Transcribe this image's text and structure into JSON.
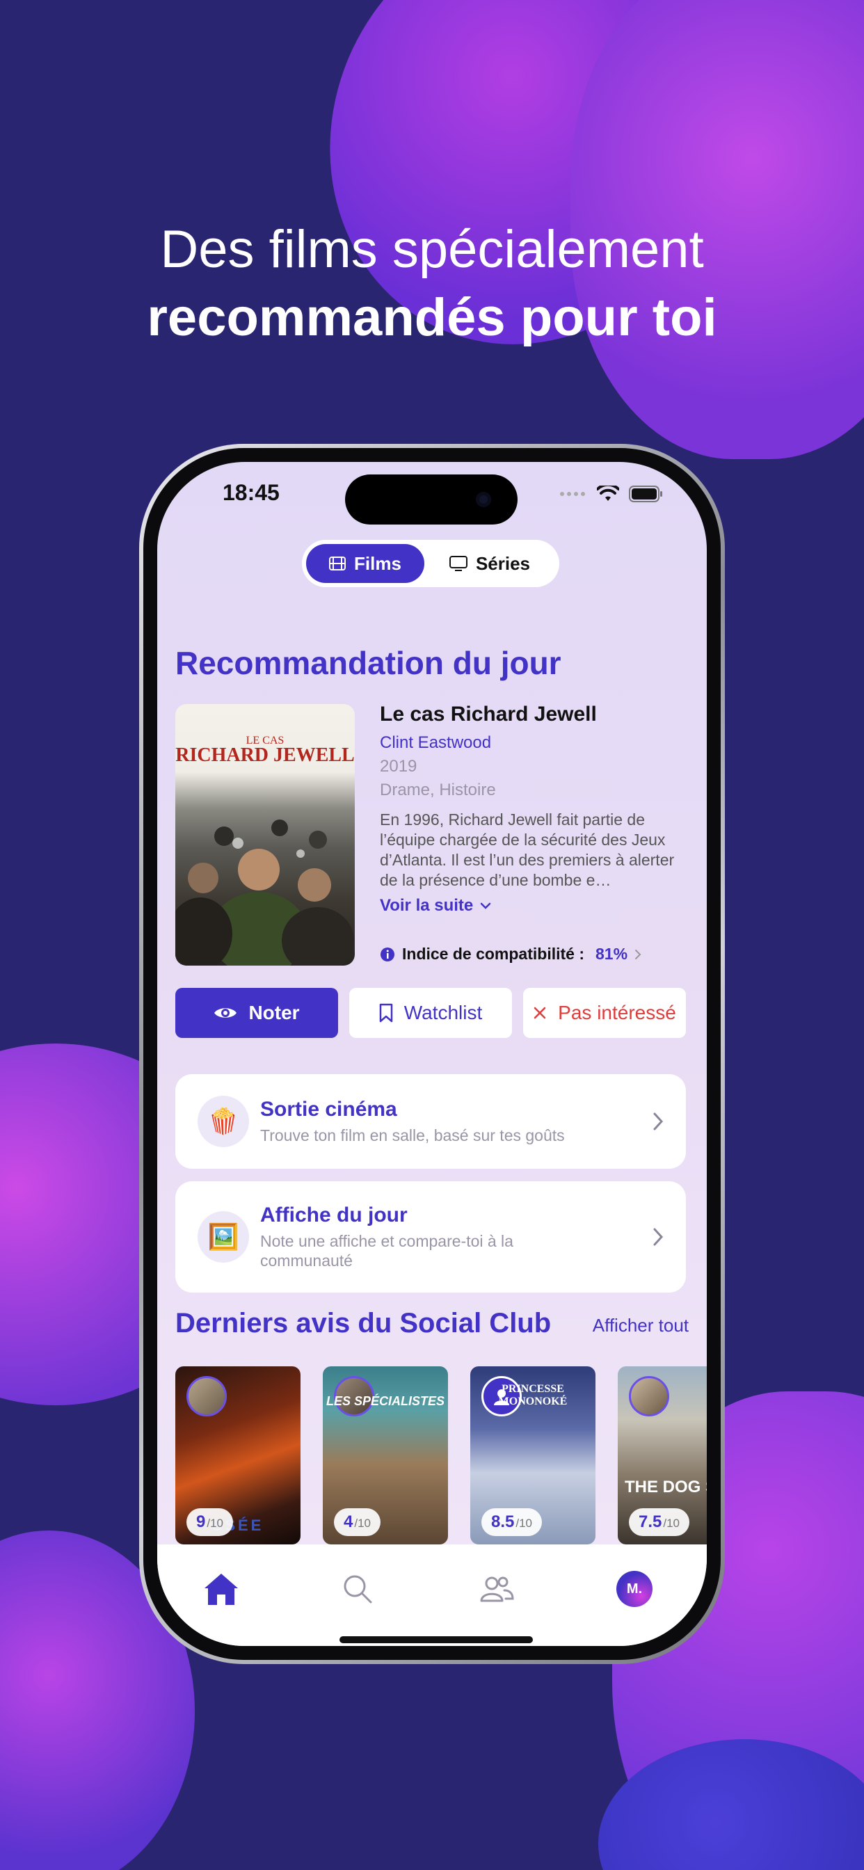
{
  "headline": {
    "line1": "Des films spécialement",
    "line2": "recommandés pour toi"
  },
  "status_bar": {
    "time": "18:45",
    "icons": [
      "signal-dots-icon",
      "wifi-icon",
      "battery-icon"
    ]
  },
  "segmented": {
    "active": {
      "label": "Films",
      "icon": "film-icon"
    },
    "inactive": {
      "label": "Séries",
      "icon": "tv-icon"
    }
  },
  "recommendation": {
    "section_title": "Recommandation du jour",
    "poster": {
      "top_text": "LE CAS",
      "title_text": "RICHARD JEWELL"
    },
    "title": "Le cas Richard Jewell",
    "director": "Clint Eastwood",
    "year": "2019",
    "genres": "Drame, Histoire",
    "synopsis": "En 1996, Richard Jewell fait partie de l’équipe chargée de la sécurité des Jeux d’Atlanta. Il est l’un des premiers à alerter de la présence d’une bombe e…",
    "read_more": "Voir la suite",
    "compatibility_label": "Indice de compatibilité :",
    "compatibility_value": "81%"
  },
  "actions": {
    "rate": "Noter",
    "watchlist": "Watchlist",
    "not_interested": "Pas intéressé"
  },
  "cards": [
    {
      "title": "Sortie cinéma",
      "subtitle": "Trouve ton film en salle, basé sur tes goûts",
      "icon": "popcorn-icon",
      "emoji": "🍿"
    },
    {
      "title": "Affiche du jour",
      "subtitle": "Note une affiche et compare-toi à la communauté",
      "icon": "framed-picture-icon",
      "emoji": "🖼️"
    }
  ],
  "social": {
    "title": "Derniers avis du Social Club",
    "see_all": "Afficher tout",
    "reviews": [
      {
        "score": "9",
        "scale": "/10",
        "caption": "SSÉE"
      },
      {
        "score": "4",
        "scale": "/10",
        "caption": "LES SPÉCIALISTES"
      },
      {
        "score": "8.5",
        "scale": "/10",
        "caption": "PRINCESSE MONONOKÉ"
      },
      {
        "score": "7.5",
        "scale": "/10",
        "caption": "THE DOG STARS"
      }
    ]
  },
  "tabbar": {
    "items": [
      "home-icon",
      "search-icon",
      "community-icon",
      "profile-avatar"
    ],
    "avatar_initials": "M."
  },
  "colors": {
    "accent": "#4232c5",
    "danger": "#e03c3c",
    "background": "#2a2570"
  }
}
